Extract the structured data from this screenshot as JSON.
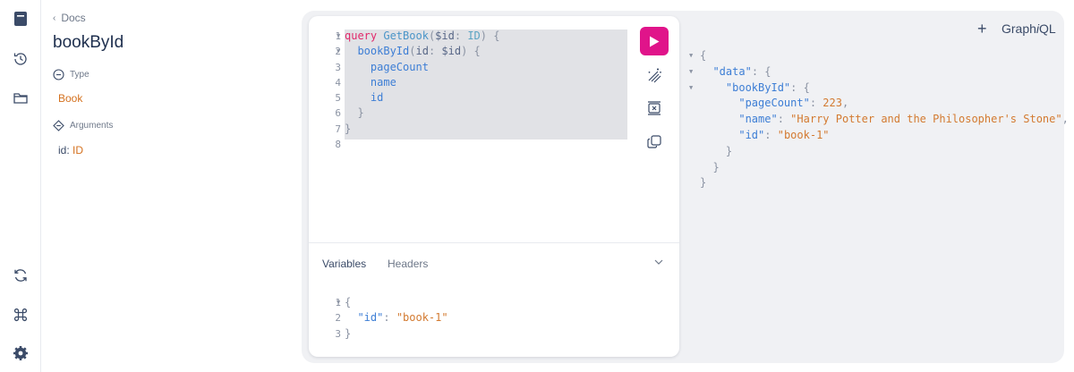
{
  "app": {
    "logo_prefix": "Graph",
    "logo_i": "i",
    "logo_suffix": "QL",
    "add_tab_label": "+"
  },
  "rail": {
    "icons": [
      "docs-icon",
      "history-icon",
      "folder-icon",
      "refetch-icon",
      "command-icon",
      "settings-icon"
    ]
  },
  "docs": {
    "back_label": "Docs",
    "title": "bookById",
    "type_section": "Type",
    "type_value": "Book",
    "args_section": "Arguments",
    "arg_name": "id",
    "arg_sep": ": ",
    "arg_type": "ID"
  },
  "editor": {
    "line_numbers": [
      "1",
      "2",
      "3",
      "4",
      "5",
      "6",
      "7",
      "8"
    ],
    "lines": [
      [
        {
          "t": "query",
          "c": "kw"
        },
        {
          "t": " ",
          "c": "punct"
        },
        {
          "t": "GetBook",
          "c": "fn"
        },
        {
          "t": "(",
          "c": "punct"
        },
        {
          "t": "$id",
          "c": "var"
        },
        {
          "t": ": ",
          "c": "punct"
        },
        {
          "t": "ID",
          "c": "type"
        },
        {
          "t": ") {",
          "c": "punct"
        }
      ],
      [
        {
          "t": "  ",
          "c": "punct"
        },
        {
          "t": "bookById",
          "c": "field"
        },
        {
          "t": "(",
          "c": "punct"
        },
        {
          "t": "id",
          "c": "var"
        },
        {
          "t": ": ",
          "c": "punct"
        },
        {
          "t": "$id",
          "c": "var"
        },
        {
          "t": ") {",
          "c": "punct"
        }
      ],
      [
        {
          "t": "    ",
          "c": "punct"
        },
        {
          "t": "pageCount",
          "c": "field"
        }
      ],
      [
        {
          "t": "    ",
          "c": "punct"
        },
        {
          "t": "name",
          "c": "field"
        }
      ],
      [
        {
          "t": "    ",
          "c": "punct"
        },
        {
          "t": "id",
          "c": "field"
        }
      ],
      [
        {
          "t": "  }",
          "c": "punct"
        }
      ],
      [
        {
          "t": "}",
          "c": "punct"
        }
      ],
      []
    ]
  },
  "variables": {
    "tab_variables": "Variables",
    "tab_headers": "Headers",
    "line_numbers": [
      "1",
      "2",
      "3"
    ],
    "lines": [
      [
        {
          "t": "{",
          "c": "punct"
        }
      ],
      [
        {
          "t": "  ",
          "c": "punct"
        },
        {
          "t": "\"id\"",
          "c": "prop"
        },
        {
          "t": ": ",
          "c": "punct"
        },
        {
          "t": "\"book-1\"",
          "c": "str"
        }
      ],
      [
        {
          "t": "}",
          "c": "punct"
        }
      ]
    ]
  },
  "result": {
    "lines": [
      {
        "fold": true,
        "parts": [
          {
            "t": "{",
            "c": "punct"
          }
        ]
      },
      {
        "fold": true,
        "parts": [
          {
            "t": "  ",
            "c": "punct"
          },
          {
            "t": "\"data\"",
            "c": "prop"
          },
          {
            "t": ": {",
            "c": "punct"
          }
        ]
      },
      {
        "fold": true,
        "parts": [
          {
            "t": "    ",
            "c": "punct"
          },
          {
            "t": "\"bookById\"",
            "c": "prop"
          },
          {
            "t": ": {",
            "c": "punct"
          }
        ]
      },
      {
        "fold": false,
        "parts": [
          {
            "t": "      ",
            "c": "punct"
          },
          {
            "t": "\"pageCount\"",
            "c": "prop"
          },
          {
            "t": ": ",
            "c": "punct"
          },
          {
            "t": "223",
            "c": "num"
          },
          {
            "t": ",",
            "c": "punct"
          }
        ]
      },
      {
        "fold": false,
        "parts": [
          {
            "t": "      ",
            "c": "punct"
          },
          {
            "t": "\"name\"",
            "c": "prop"
          },
          {
            "t": ": ",
            "c": "punct"
          },
          {
            "t": "\"Harry Potter and the Philosopher's Stone\"",
            "c": "str"
          },
          {
            "t": ",",
            "c": "punct"
          }
        ]
      },
      {
        "fold": false,
        "parts": [
          {
            "t": "      ",
            "c": "punct"
          },
          {
            "t": "\"id\"",
            "c": "prop"
          },
          {
            "t": ": ",
            "c": "punct"
          },
          {
            "t": "\"book-1\"",
            "c": "str"
          }
        ]
      },
      {
        "fold": false,
        "parts": [
          {
            "t": "    }",
            "c": "punct"
          }
        ]
      },
      {
        "fold": false,
        "parts": [
          {
            "t": "  }",
            "c": "punct"
          }
        ]
      },
      {
        "fold": false,
        "parts": [
          {
            "t": "}",
            "c": "punct"
          }
        ]
      }
    ]
  },
  "colors": {
    "accent": "#e0148a",
    "link": "#d4711f",
    "keyword": "#e1286a",
    "field": "#3d7ed5"
  }
}
